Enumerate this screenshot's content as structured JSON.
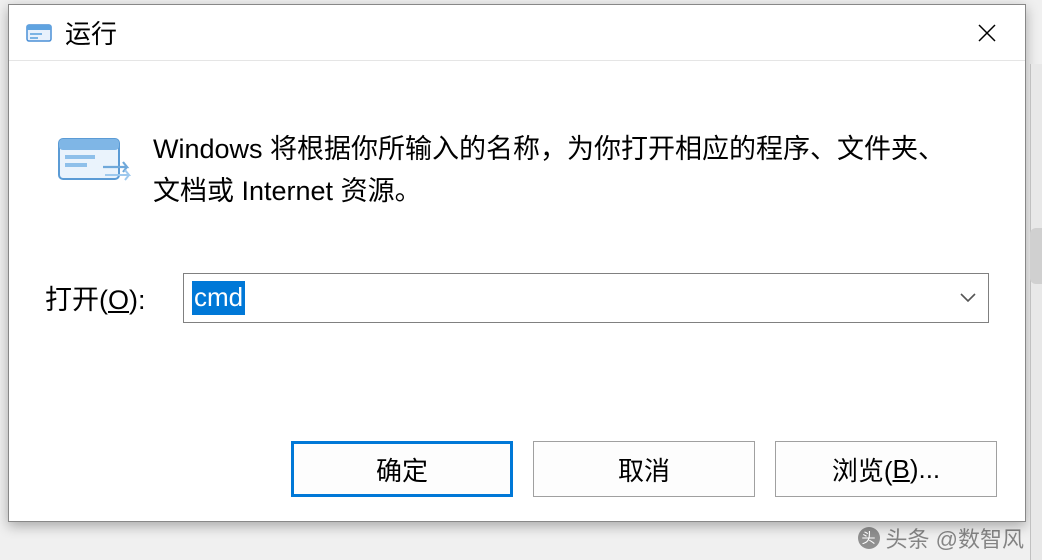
{
  "titlebar": {
    "title": "运行",
    "close_label": "✕"
  },
  "content": {
    "description": "Windows 将根据你所输入的名称，为你打开相应的程序、文件夹、文档或 Internet 资源。",
    "open_label_prefix": "打开(",
    "open_label_key": "O",
    "open_label_suffix": "):",
    "input_value": "cmd"
  },
  "buttons": {
    "ok": "确定",
    "cancel": "取消",
    "browse_prefix": "浏览(",
    "browse_key": "B",
    "browse_suffix": ")..."
  },
  "watermark": {
    "text": "头条 @数智风"
  }
}
